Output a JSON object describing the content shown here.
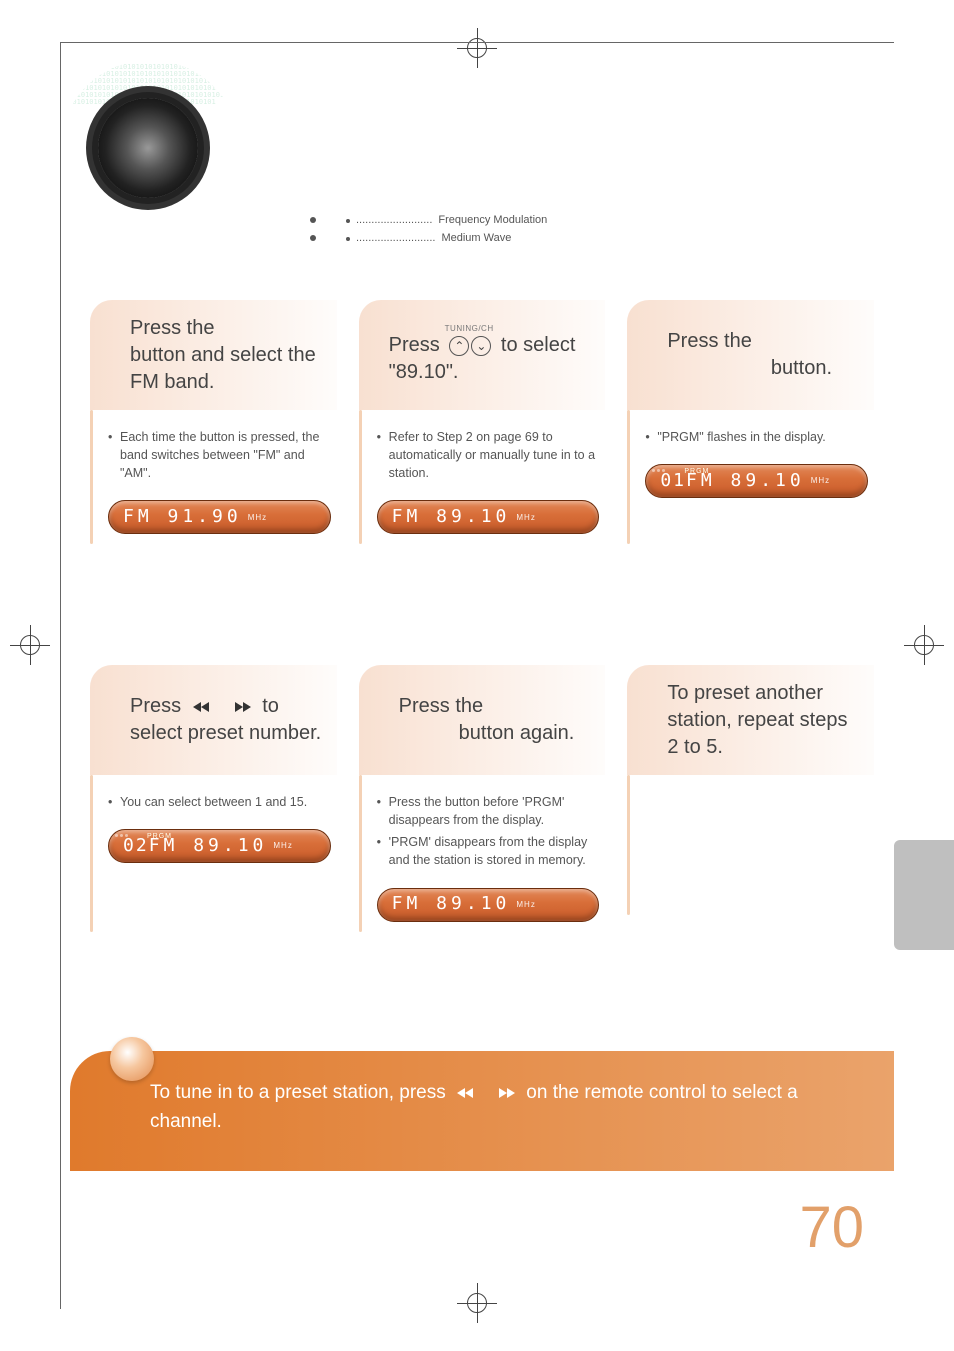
{
  "definitions": [
    {
      "dashes": ".........................",
      "term": "Frequency Modulation"
    },
    {
      "dashes": "..........................",
      "term": "Medium Wave"
    }
  ],
  "steps": {
    "s1": {
      "line1": "Press the",
      "line2": "button  and select the FM band.",
      "body": "Each time the button is pressed, the band switches between \"FM\" and \"AM\".",
      "lcd": "FM  91.90",
      "unit": "MHz"
    },
    "s2": {
      "tuning_label": "TUNING/CH",
      "line_a": "Press ",
      "line_b": " to select \"89.10\".",
      "body": "Refer to Step 2 on page 69 to automatically or manually tune in to a station.",
      "lcd": "FM  89.10",
      "unit": "MHz"
    },
    "s3": {
      "line1": "Press the",
      "line2": "button.",
      "body": "\"PRGM\" flashes in the display.",
      "pre": "01",
      "prgm": "PRGM",
      "lcd": "FM  89.10",
      "unit": "MHz"
    },
    "s4": {
      "line_a": "Press ",
      "line_b": " to select preset number.",
      "body": "You can select between 1 and 15.",
      "pre": "02",
      "prgm": "PRGM",
      "lcd": "FM  89.10",
      "unit": "MHz"
    },
    "s5": {
      "line1": "Press the",
      "line2": "button again.",
      "body1": "Press the                             button before 'PRGM' disappears from the display.",
      "body2": "'PRGM' disappears from the display and the station is stored in memory.",
      "lcd": "FM  89.10",
      "unit": "MHz"
    },
    "s6": {
      "text": "To preset another station, repeat steps 2 to 5."
    }
  },
  "footer": {
    "line_a": "To tune in to a preset station, press ",
    "line_b": " on the remote control to select a channel."
  },
  "page_number": "70"
}
